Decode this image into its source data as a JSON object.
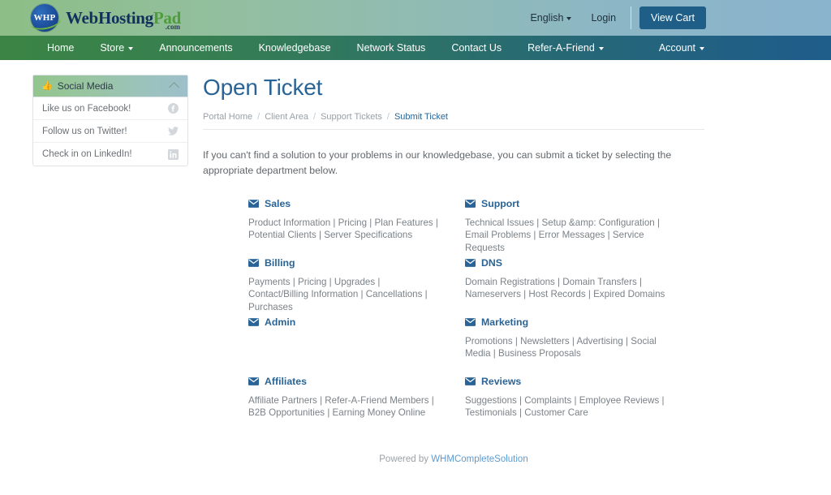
{
  "brand": {
    "badge_text": "WHP",
    "name_part1": "WebHosting",
    "name_part2": "Pad",
    "dotcom": ".com",
    "accent_green": "#4f9c3a",
    "accent_navy": "#12305e"
  },
  "topbar": {
    "language": "English",
    "login": "Login",
    "cart_button": "View Cart"
  },
  "nav": {
    "items": [
      {
        "label": "Home",
        "has_caret": false
      },
      {
        "label": "Store",
        "has_caret": true
      },
      {
        "label": "Announcements",
        "has_caret": false
      },
      {
        "label": "Knowledgebase",
        "has_caret": false
      },
      {
        "label": "Network Status",
        "has_caret": false
      },
      {
        "label": "Contact Us",
        "has_caret": false
      },
      {
        "label": "Refer-A-Friend",
        "has_caret": true
      }
    ],
    "account": "Account"
  },
  "sidebar": {
    "panel_title": "Social Media",
    "panel_icon": "thumbs-up-icon",
    "collapse_icon": "chevron-up-icon",
    "items": [
      {
        "label": "Like us on Facebook!",
        "icon": "facebook-icon"
      },
      {
        "label": "Follow us on Twitter!",
        "icon": "twitter-icon"
      },
      {
        "label": "Check in on LinkedIn!",
        "icon": "linkedin-icon"
      }
    ]
  },
  "main": {
    "title": "Open Ticket",
    "breadcrumb": [
      {
        "label": "Portal Home",
        "active": false
      },
      {
        "label": "Client Area",
        "active": false
      },
      {
        "label": "Support Tickets",
        "active": false
      },
      {
        "label": "Submit Ticket",
        "active": true
      }
    ],
    "breadcrumb_separator": "/",
    "intro": "If you can't find a solution to your problems in our knowledgebase, you can submit a ticket by selecting the appropriate department below.",
    "departments": [
      {
        "name": "Sales",
        "icon": "envelope-icon",
        "description": "Product Information | Pricing | Plan Features | Potential Clients | Server Specifications"
      },
      {
        "name": "Support",
        "icon": "envelope-icon",
        "description": "Technical Issues | Setup &amp: Configuration | Email Problems | Error Messages | Service Requests"
      },
      {
        "name": "Billing",
        "icon": "envelope-icon",
        "description": "Payments | Pricing | Upgrades | Contact/Billing Information | Cancellations | Purchases"
      },
      {
        "name": "DNS",
        "icon": "envelope-icon",
        "description": "Domain Registrations | Domain Transfers | Nameservers | Host Records | Expired Domains"
      },
      {
        "name": "Admin",
        "icon": "envelope-icon",
        "description": ""
      },
      {
        "name": "Marketing",
        "icon": "envelope-icon",
        "description": "Promotions | Newsletters | Advertising | Social Media | Business Proposals"
      },
      {
        "name": "Affiliates",
        "icon": "envelope-icon",
        "description": "Affiliate Partners | Refer-A-Friend Members | B2B Opportunities | Earning Money Online"
      },
      {
        "name": "Reviews",
        "icon": "envelope-icon",
        "description": "Suggestions | Complaints | Employee Reviews | Testimonials | Customer Care"
      }
    ]
  },
  "footer": {
    "prefix": "Powered by ",
    "link": "WHMCompleteSolution"
  }
}
